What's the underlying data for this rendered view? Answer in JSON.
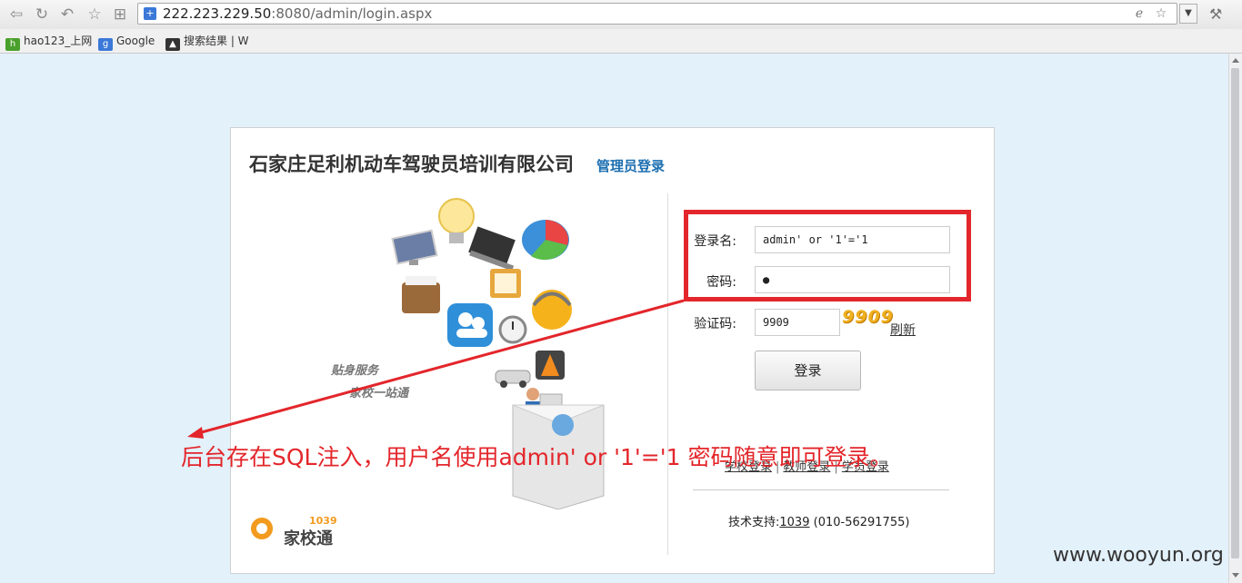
{
  "browser": {
    "url_host": "222.223.229.50",
    "url_rest": ":8080/admin/login.aspx",
    "bookmarks": [
      {
        "label": "hao123_上网",
        "icon": "hao123-icon"
      },
      {
        "label": "Google",
        "icon": "google-icon"
      },
      {
        "label": "搜索结果 | W",
        "icon": "search-result-icon"
      }
    ]
  },
  "page": {
    "company_title": "石家庄足利机动车驾驶员培训有限公司",
    "admin_login_label": "管理员登录",
    "slogan1": "贴身服务",
    "slogan2": "家校一站通",
    "brand_num": "1039",
    "brand_name": "家校通"
  },
  "form": {
    "username_label": "登录名:",
    "username_value": "admin' or '1'='1",
    "password_label": "密码:",
    "password_value": "●",
    "captcha_label": "验证码:",
    "captcha_value": "9909",
    "captcha_image_text": "9909",
    "refresh_label": "刷新",
    "login_button": "登录"
  },
  "links": [
    {
      "label": "学校登录"
    },
    {
      "label": "教师登录"
    },
    {
      "label": "学员登录"
    }
  ],
  "links_separator": "|",
  "support": {
    "label": "技术支持:",
    "link": "1039",
    "phone": "(010-56291755)"
  },
  "annotation": {
    "text": "后台存在SQL注入，用户名使用admin' or '1'='1 密码随意即可登录。",
    "color": "#e3262b"
  },
  "watermark": "www.wooyun.org",
  "colors": {
    "page_background": "#e3f1fb",
    "title_blue": "#1d6fb1",
    "brand_orange": "#f29b1e"
  }
}
